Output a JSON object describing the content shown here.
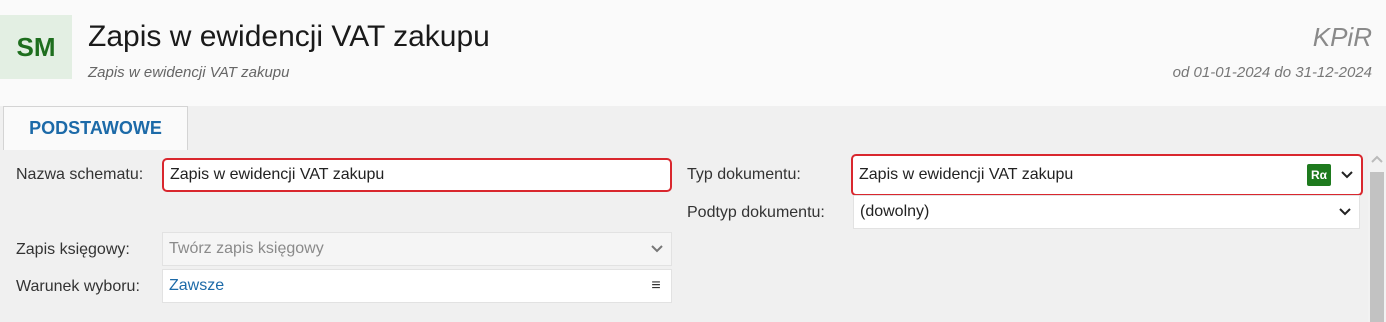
{
  "header": {
    "avatar": "SM",
    "title": "Zapis w ewidencji VAT zakupu",
    "subtitle": "Zapis w ewidencji VAT zakupu",
    "module": "KPiR",
    "period": "od 01-01-2024 do 31-12-2024"
  },
  "tabs": [
    {
      "label": "PODSTAWOWE",
      "active": true
    }
  ],
  "form": {
    "schema_name_label": "Nazwa schematu:",
    "schema_name_value": "Zapis w ewidencji VAT zakupu",
    "doc_type_label": "Typ dokumentu:",
    "doc_type_value": "Zapis w ewidencji VAT zakupu",
    "doc_type_badge": "Rα",
    "doc_subtype_label": "Podtyp dokumentu:",
    "doc_subtype_value": "(dowolny)",
    "entry_label": "Zapis księgowy:",
    "entry_value": "Twórz zapis księgowy",
    "condition_label": "Warunek wyboru:",
    "condition_value": "Zawsze",
    "condition_menu": "≡"
  },
  "colors": {
    "accent": "#1c6aa8",
    "highlight_border": "#d9272e",
    "avatar_bg": "#e3efe3",
    "avatar_text": "#1e6e1e",
    "badge_bg": "#1e7a1e"
  }
}
